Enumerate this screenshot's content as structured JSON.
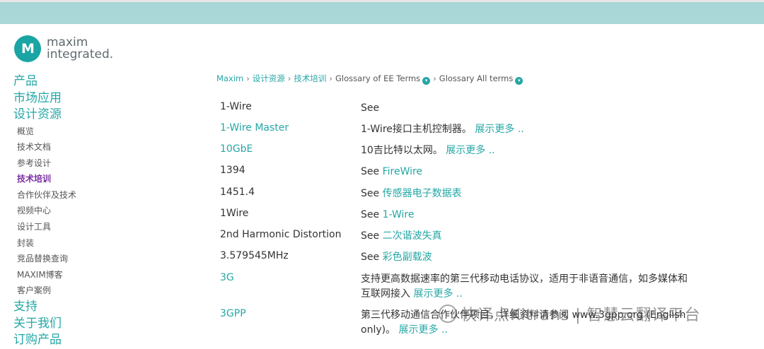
{
  "logo": {
    "mark": "M",
    "line1": "maxim",
    "line2": "integrated."
  },
  "nav": {
    "top": [
      {
        "label": "产品",
        "name": "nav-products"
      },
      {
        "label": "市场应用",
        "name": "nav-markets"
      },
      {
        "label": "设计资源",
        "name": "nav-design-resources"
      }
    ],
    "sub": [
      {
        "label": "概览",
        "name": "nav-sub-overview"
      },
      {
        "label": "技术文档",
        "name": "nav-sub-tech-docs"
      },
      {
        "label": "参考设计",
        "name": "nav-sub-reference-designs"
      },
      {
        "label": "技术培训",
        "name": "nav-sub-tech-training",
        "active": true
      },
      {
        "label": "合作伙伴及技术",
        "name": "nav-sub-partners"
      },
      {
        "label": "视频中心",
        "name": "nav-sub-video-center"
      },
      {
        "label": "设计工具",
        "name": "nav-sub-design-tools"
      },
      {
        "label": "封装",
        "name": "nav-sub-packaging"
      },
      {
        "label": "竞品替换查询",
        "name": "nav-sub-cross-reference"
      },
      {
        "label": "MAXIM博客",
        "name": "nav-sub-blog"
      },
      {
        "label": "客户案例",
        "name": "nav-sub-customer-cases"
      }
    ],
    "bottom": [
      {
        "label": "支持",
        "name": "nav-support"
      },
      {
        "label": "关于我们",
        "name": "nav-about"
      },
      {
        "label": "订购产品",
        "name": "nav-order"
      }
    ]
  },
  "breadcrumb": {
    "items": [
      "Maxim",
      "设计资源",
      "技术培训",
      "Glossary of EE Terms",
      "Glossary All terms"
    ],
    "separator": "›",
    "dropdown_icon": "chevron-down-icon"
  },
  "glossary": [
    {
      "term": "1-Wire",
      "term_link": false,
      "def": "See",
      "def_link": "",
      "more": ""
    },
    {
      "term": "1-Wire Master",
      "term_link": true,
      "def": "1-Wire接口主机控制器。",
      "def_link": "",
      "more": "展示更多 .."
    },
    {
      "term": "10GbE",
      "term_link": true,
      "def": "10吉比特以太网。",
      "def_link": "",
      "more": "展示更多 .."
    },
    {
      "term": "1394",
      "term_link": false,
      "def": "See",
      "def_link": "FireWire",
      "more": ""
    },
    {
      "term": "1451.4",
      "term_link": false,
      "def": "See",
      "def_link": "传感器电子数据表",
      "more": ""
    },
    {
      "term": "1Wire",
      "term_link": false,
      "def": "See",
      "def_link": "1-Wire",
      "more": ""
    },
    {
      "term": "2nd Harmonic Distortion",
      "term_link": false,
      "def": "See",
      "def_link": "二次谐波失真",
      "more": ""
    },
    {
      "term": "3.579545MHz",
      "term_link": false,
      "def": "See",
      "def_link": "彩色副载波",
      "more": ""
    },
    {
      "term": "3G",
      "term_link": true,
      "def": "支持更高数据速率的第三代移动电话协议，适用于非语音通信，如多媒体和互联网接入",
      "def_link": "",
      "more": "展示更多 .."
    },
    {
      "term": "3GPP",
      "term_link": true,
      "def": "第三代移动通信合作伙伴项目，详细资料请参阅 www.3gpp.org (English only)。",
      "def_link": "",
      "more": "展示更多 .."
    }
  ],
  "watermark": "快译点Kitrans | 智慧云翻译平台",
  "colors": {
    "accent": "#25a7a6",
    "topbar": "#a9d6d6",
    "active_nav": "#7a2fa0"
  }
}
